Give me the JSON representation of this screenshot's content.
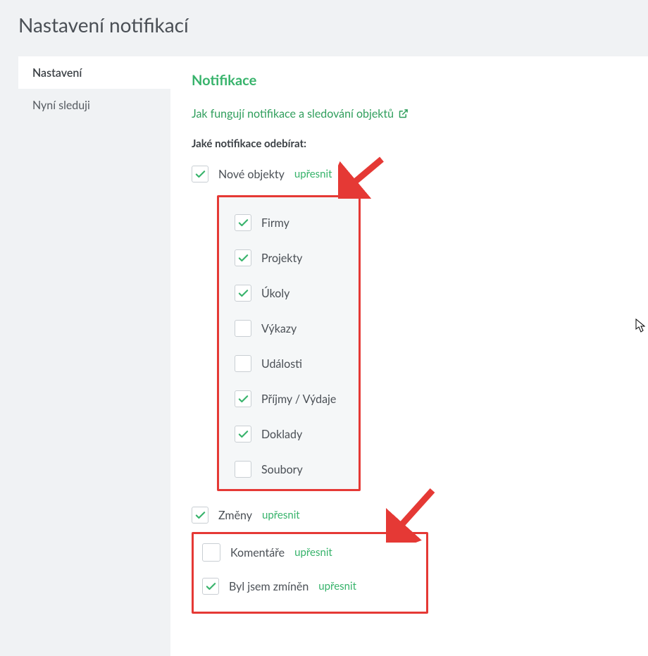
{
  "page": {
    "title": "Nastavení notifikací"
  },
  "sidebar": {
    "items": [
      {
        "label": "Nastavení",
        "active": true
      },
      {
        "label": "Nyní sleduji",
        "active": false
      }
    ]
  },
  "content": {
    "section_title": "Notifikace",
    "help_link": "Jak fungují notifikace a sledování objektů",
    "sub_head": "Jaké notifikace odebírat:",
    "refine": "upřesnit",
    "groups": [
      {
        "label": "Nové objekty",
        "checked": true,
        "refine": true
      },
      {
        "label": "Změny",
        "checked": true,
        "refine": true
      },
      {
        "label": "Komentáře",
        "checked": false,
        "refine": true
      },
      {
        "label": "Byl jsem zmíněn",
        "checked": true,
        "refine": true
      }
    ],
    "nested": [
      {
        "label": "Firmy",
        "checked": true
      },
      {
        "label": "Projekty",
        "checked": true
      },
      {
        "label": "Úkoly",
        "checked": true
      },
      {
        "label": "Výkazy",
        "checked": false
      },
      {
        "label": "Události",
        "checked": false
      },
      {
        "label": "Příjmy / Výdaje",
        "checked": true
      },
      {
        "label": "Doklady",
        "checked": true
      },
      {
        "label": "Soubory",
        "checked": false
      }
    ]
  },
  "annotations": {
    "highlight_color": "#e53935"
  }
}
